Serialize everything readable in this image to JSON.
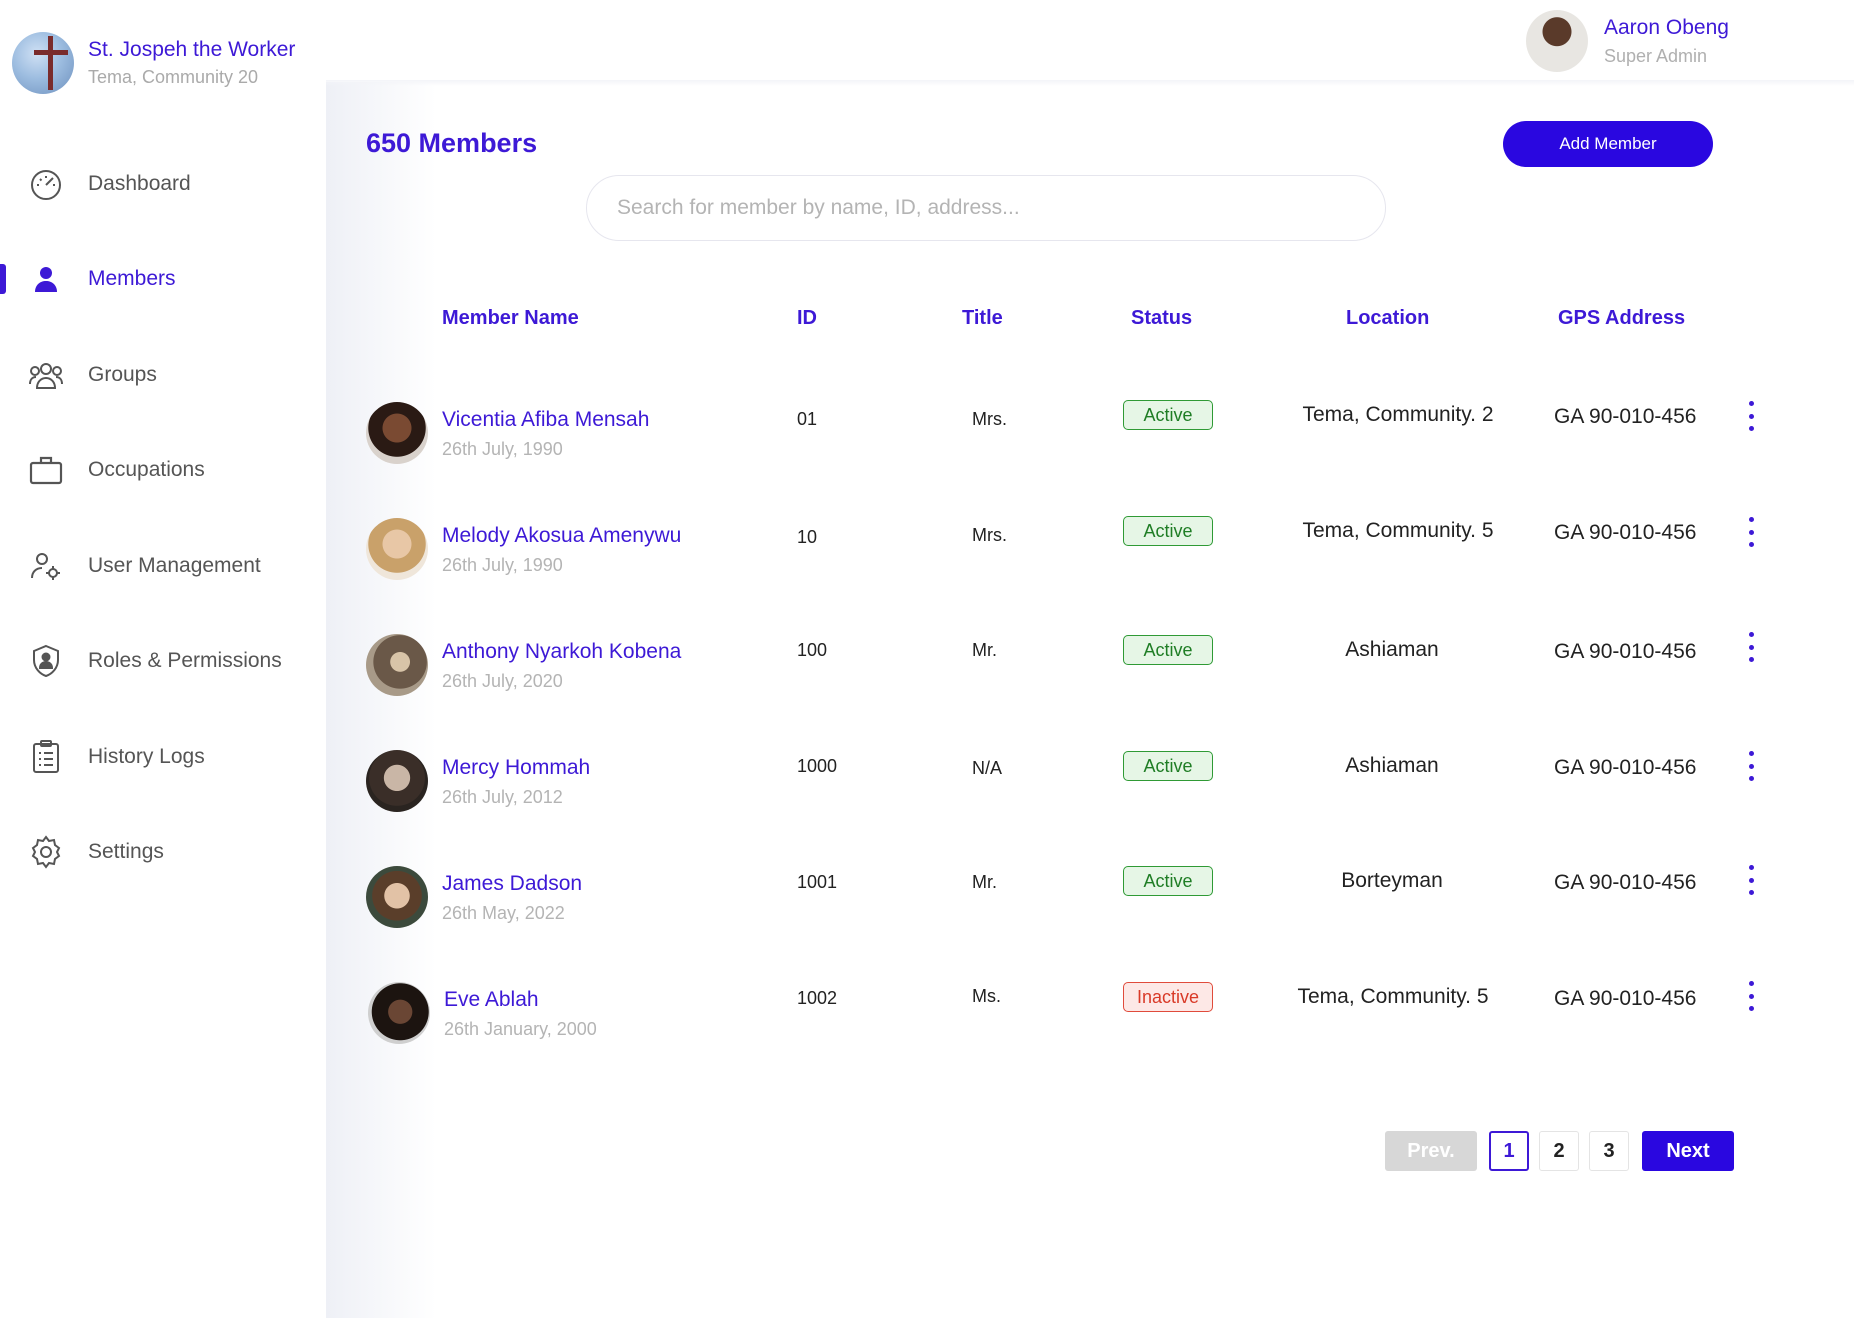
{
  "org": {
    "name": "St. Jospeh the Worker",
    "location": "Tema, Community 20"
  },
  "user": {
    "name": "Aaron Obeng",
    "role": "Super Admin"
  },
  "nav": [
    {
      "label": "Dashboard",
      "icon": "speedometer-icon"
    },
    {
      "label": "Members",
      "icon": "person-icon",
      "active": true
    },
    {
      "label": "Groups",
      "icon": "group-icon"
    },
    {
      "label": "Occupations",
      "icon": "briefcase-icon"
    },
    {
      "label": "User Management",
      "icon": "user-gear-icon"
    },
    {
      "label": "Roles & Permissions",
      "icon": "shield-person-icon"
    },
    {
      "label": "History Logs",
      "icon": "clipboard-list-icon"
    },
    {
      "label": "Settings",
      "icon": "gear-icon"
    }
  ],
  "page": {
    "title": "650 Members",
    "add_button": "Add Member"
  },
  "search": {
    "placeholder": "Search for member by name, ID, address..."
  },
  "table": {
    "headers": [
      "Member Name",
      "ID",
      "Title",
      "Status",
      "Location",
      "GPS Address"
    ],
    "rows": [
      {
        "name": "Vicentia Afiba Mensah",
        "date": "26th July, 1990",
        "id": "01",
        "title": "Mrs.",
        "status": "Active",
        "location": "Tema, Community. 2",
        "gps": "GA 90-010-456"
      },
      {
        "name": "Melody Akosua Amenywu",
        "date": "26th July, 1990",
        "id": "10",
        "title": "Mrs.",
        "status": "Active",
        "location": "Tema, Community. 5",
        "gps": "GA 90-010-456"
      },
      {
        "name": "Anthony Nyarkoh Kobena",
        "date": "26th July, 2020",
        "id": "100",
        "title": "Mr.",
        "status": "Active",
        "location": "Ashiaman",
        "gps": "GA 90-010-456"
      },
      {
        "name": "Mercy Hommah",
        "date": "26th July, 2012",
        "id": "1000",
        "title": "N/A",
        "status": "Active",
        "location": "Ashiaman",
        "gps": "GA 90-010-456"
      },
      {
        "name": "James Dadson",
        "date": "26th May, 2022",
        "id": "1001",
        "title": "Mr.",
        "status": "Active",
        "location": "Borteyman",
        "gps": "GA 90-010-456"
      },
      {
        "name": "Eve Ablah",
        "date": "26th January, 2000",
        "id": "1002",
        "title": "Ms.",
        "status": "Inactive",
        "location": "Tema, Community. 5",
        "gps": "GA 90-010-456"
      }
    ]
  },
  "pagination": {
    "prev": "Prev.",
    "pages": [
      "1",
      "2",
      "3"
    ],
    "current": "1",
    "next": "Next"
  },
  "colors": {
    "accent": "#3d19d6",
    "button": "#2a07e0",
    "active_status": "#1f7d25",
    "inactive_status": "#d93a28"
  }
}
